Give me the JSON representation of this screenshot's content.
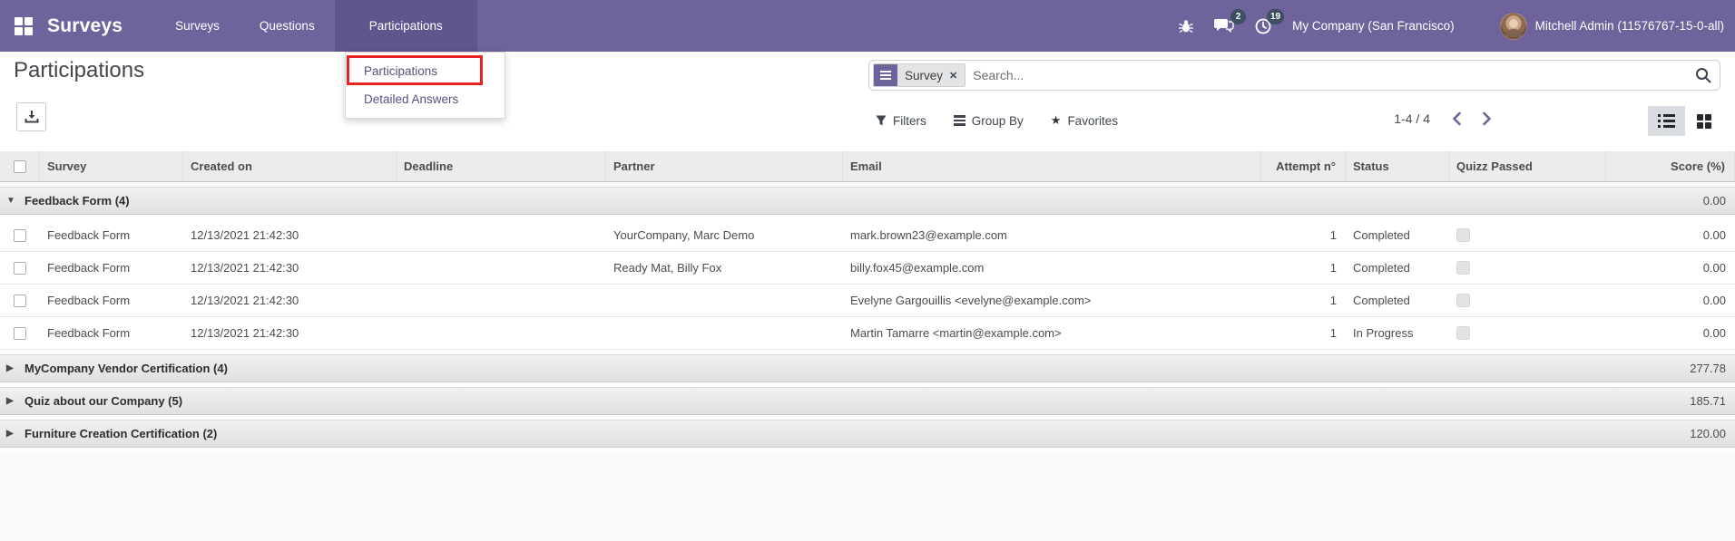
{
  "colors": {
    "navbar_bg": "#6f639c",
    "navbar_active_bg": "#5f568e",
    "badge_bg": "#3e4f63",
    "annotation_red": "#e62222",
    "view_switch_active_bg": "#d9dde2"
  },
  "navbar": {
    "brand": "Surveys",
    "menu": [
      {
        "label": "Surveys",
        "active": false
      },
      {
        "label": "Questions",
        "active": false
      },
      {
        "label": "Participations",
        "active": true
      }
    ],
    "messages_badge": "2",
    "activities_badge": "19",
    "company": "My Company (San Francisco)",
    "user": "Mitchell Admin (11576767-15-0-all)"
  },
  "menu_dropdown": {
    "items": [
      {
        "label": "Participations"
      },
      {
        "label": "Detailed Answers"
      }
    ]
  },
  "page": {
    "title": "Participations"
  },
  "search": {
    "facet_label": "Survey",
    "facet_remove": "✕",
    "placeholder": "Search..."
  },
  "controls": {
    "filters": "Filters",
    "group_by": "Group By",
    "favorites": "Favorites",
    "pager": "1-4 / 4"
  },
  "icons": {
    "caret_expanded": "▼",
    "caret_collapsed": "▶",
    "star": "★"
  },
  "table": {
    "headers": {
      "survey": "Survey",
      "created_on": "Created on",
      "deadline": "Deadline",
      "partner": "Partner",
      "email": "Email",
      "attempt": "Attempt n°",
      "status": "Status",
      "quizz_passed": "Quizz Passed",
      "score": "Score (%)"
    },
    "groups": [
      {
        "label": "Feedback Form (4)",
        "expanded": true,
        "score": "0.00",
        "rows": [
          {
            "survey": "Feedback Form",
            "created_on": "12/13/2021 21:42:30",
            "deadline": "",
            "partner": "YourCompany, Marc Demo",
            "email": "mark.brown23@example.com",
            "attempt": "1",
            "status": "Completed",
            "score": "0.00"
          },
          {
            "survey": "Feedback Form",
            "created_on": "12/13/2021 21:42:30",
            "deadline": "",
            "partner": "Ready Mat, Billy Fox",
            "email": "billy.fox45@example.com",
            "attempt": "1",
            "status": "Completed",
            "score": "0.00"
          },
          {
            "survey": "Feedback Form",
            "created_on": "12/13/2021 21:42:30",
            "deadline": "",
            "partner": "",
            "email": "Evelyne Gargouillis <evelyne@example.com>",
            "attempt": "1",
            "status": "Completed",
            "score": "0.00"
          },
          {
            "survey": "Feedback Form",
            "created_on": "12/13/2021 21:42:30",
            "deadline": "",
            "partner": "",
            "email": "Martin Tamarre <martin@example.com>",
            "attempt": "1",
            "status": "In Progress",
            "score": "0.00"
          }
        ]
      },
      {
        "label": "MyCompany Vendor Certification (4)",
        "expanded": false,
        "score": "277.78"
      },
      {
        "label": "Quiz about our Company (5)",
        "expanded": false,
        "score": "185.71"
      },
      {
        "label": "Furniture Creation Certification (2)",
        "expanded": false,
        "score": "120.00"
      }
    ]
  }
}
